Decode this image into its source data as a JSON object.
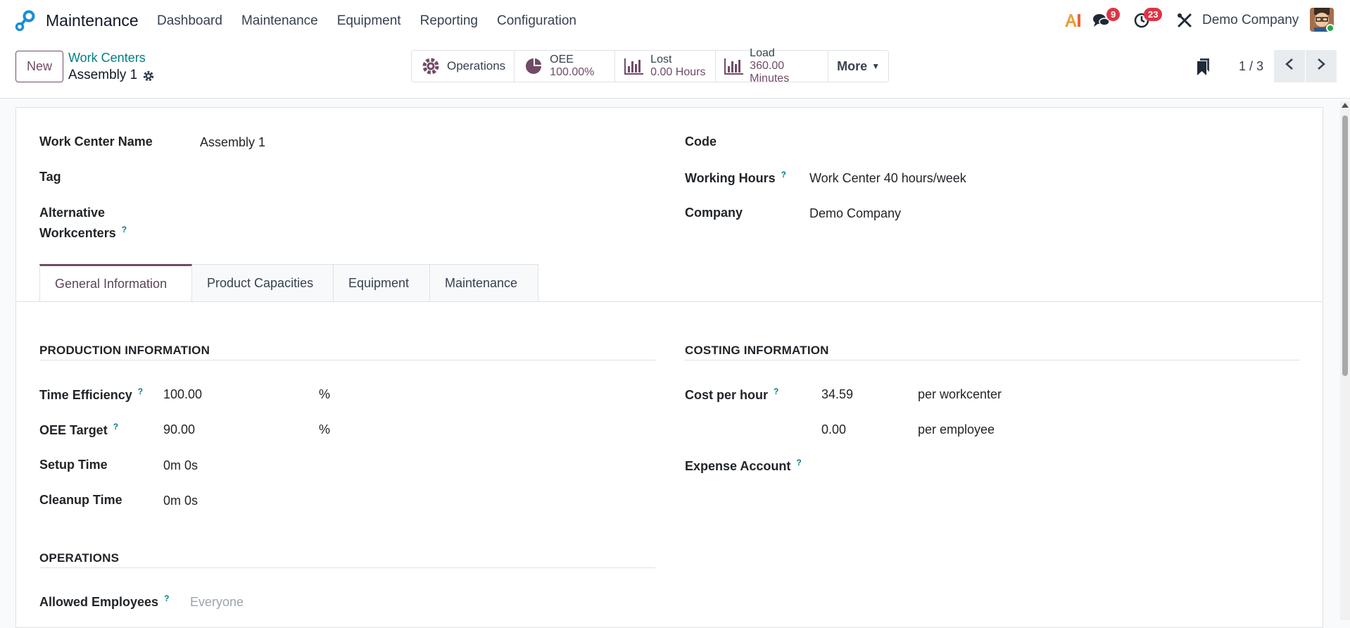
{
  "topbar": {
    "app_name": "Maintenance",
    "menu": [
      "Dashboard",
      "Maintenance",
      "Equipment",
      "Reporting",
      "Configuration"
    ],
    "messages_badge": "9",
    "activities_badge": "23",
    "company": "Demo Company",
    "ai_icon": "ai-icon",
    "brand_color": "#714b67"
  },
  "control": {
    "new_label": "New",
    "breadcrumb_parent": "Work Centers",
    "breadcrumb_current": "Assembly 1",
    "smart_buttons": {
      "operations": "Operations",
      "oee_label": "OEE",
      "oee_value": "100.00%",
      "lost_label": "Lost",
      "lost_value": "0.00 Hours",
      "load_label": "Load",
      "load_value": "360.00 Minutes",
      "more": "More"
    },
    "pager": "1 / 3"
  },
  "form": {
    "work_center_name_label": "Work Center Name",
    "work_center_name": "Assembly 1",
    "tag_label": "Tag",
    "alt_label_1": "Alternative",
    "alt_label_2": "Workcenters",
    "code_label": "Code",
    "working_hours_label": "Working Hours",
    "working_hours": "Work Center 40 hours/week",
    "company_label": "Company",
    "company": "Demo Company"
  },
  "tabs": [
    "General Information",
    "Product Capacities",
    "Equipment",
    "Maintenance"
  ],
  "production": {
    "title": "PRODUCTION INFORMATION",
    "time_efficiency_label": "Time Efficiency",
    "time_efficiency": "100.00",
    "time_efficiency_unit": "%",
    "oee_target_label": "OEE Target",
    "oee_target": "90.00",
    "oee_target_unit": "%",
    "setup_time_label": "Setup Time",
    "setup_time": "0m 0s",
    "cleanup_time_label": "Cleanup Time",
    "cleanup_time": "0m 0s"
  },
  "costing": {
    "title": "COSTING INFORMATION",
    "cost_per_hour_label": "Cost per hour",
    "cost_per_hour": "34.59",
    "cost_per_hour_unit": "per workcenter",
    "employee_cost": "0.00",
    "employee_cost_unit": "per employee",
    "expense_account_label": "Expense Account"
  },
  "operations": {
    "title": "OPERATIONS",
    "allowed_employees_label": "Allowed Employees",
    "allowed_employees_placeholder": "Everyone"
  },
  "help_mark": "?"
}
